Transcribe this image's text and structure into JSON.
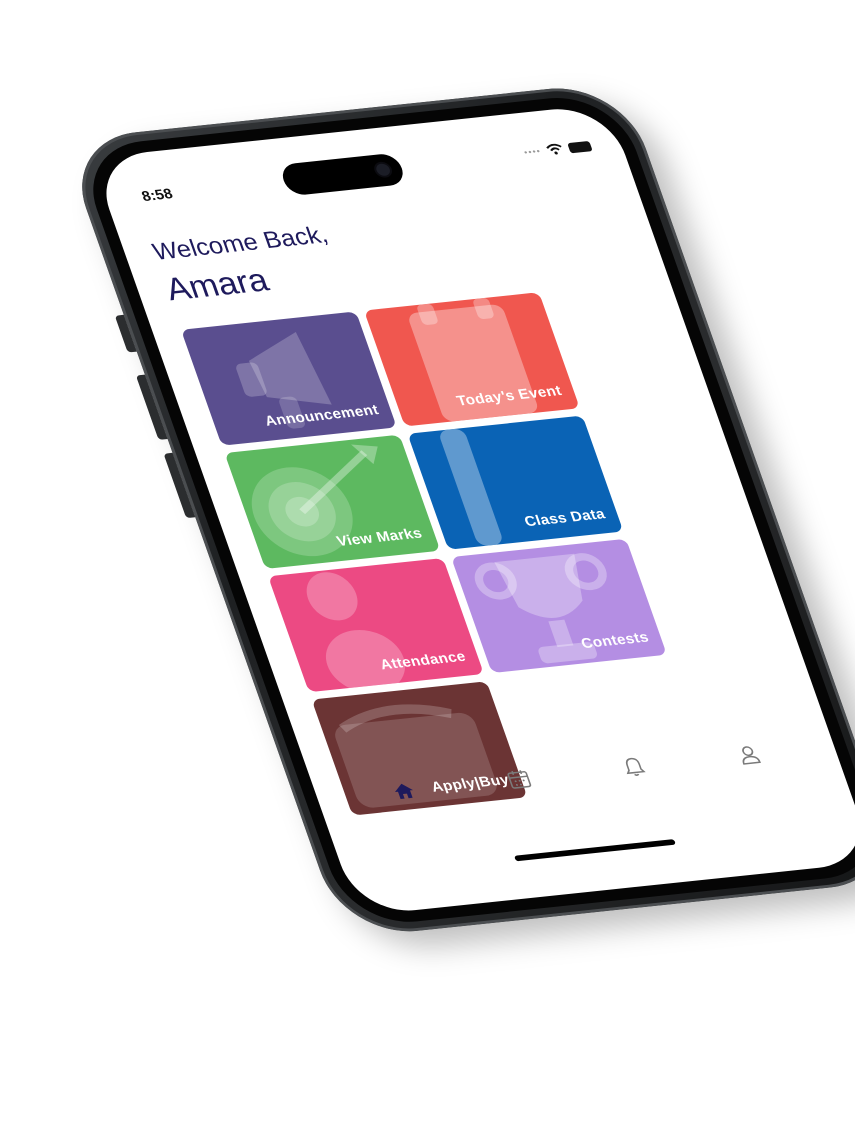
{
  "status_bar": {
    "time": "8:58"
  },
  "greeting": {
    "welcome": "Welcome Back,",
    "name": "Amara"
  },
  "tiles": [
    {
      "label": "Announcement",
      "color": "#5a4e8f"
    },
    {
      "label": "Today's Event",
      "color": "#f0574f"
    },
    {
      "label": "View Marks",
      "color": "#5db960"
    },
    {
      "label": "Class Data",
      "color": "#0a63b5"
    },
    {
      "label": "Attendance",
      "color": "#ec4a83"
    },
    {
      "label": "Contests",
      "color": "#b48ee3"
    },
    {
      "label": "Apply|Buy",
      "color": "#6b3434"
    }
  ],
  "bottom_nav": [
    {
      "icon": "home-icon",
      "active": true
    },
    {
      "icon": "calendar-icon",
      "active": false
    },
    {
      "icon": "bell-icon",
      "active": false
    },
    {
      "icon": "profile-icon",
      "active": false
    }
  ],
  "colors": {
    "accent": "#1e1a5c",
    "nav_inactive": "#7a7a7a"
  }
}
